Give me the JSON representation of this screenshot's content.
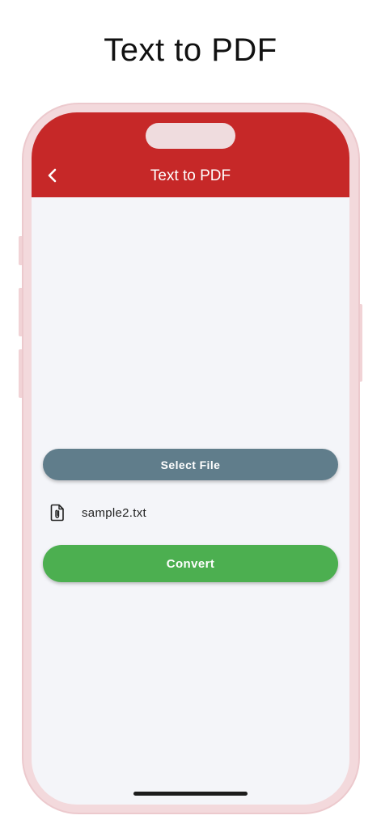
{
  "promo": {
    "title": "Text to PDF"
  },
  "appbar": {
    "title": "Text to PDF",
    "color": "#c62828",
    "back_icon": "chevron-left-icon"
  },
  "actions": {
    "select_label": "Select File",
    "select_color": "#607d8b",
    "convert_label": "Convert",
    "convert_color": "#4caf50"
  },
  "selected_file": {
    "icon": "file-attachment-icon",
    "name": "sample2.txt"
  }
}
